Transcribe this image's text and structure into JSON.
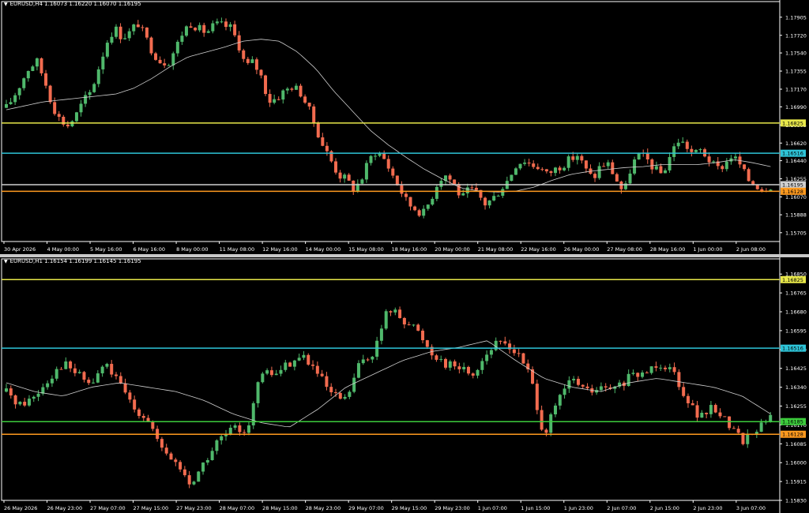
{
  "colors": {
    "background": "#000000",
    "axis": "#ffffff",
    "bull": "#4fb86b",
    "bear": "#f26b4f",
    "ma": "#d0d0d0",
    "yellow": "#e8e84a",
    "cyan": "#2ec4d8",
    "orange": "#ff9a1f",
    "green": "#3ccc3c",
    "gray": "#cfcfcf"
  },
  "chart_data": [
    {
      "type": "candlestick",
      "title": "EURUSD,H4",
      "ohlc": {
        "open": "1.16073",
        "high": "1.16220",
        "low": "1.16070",
        "close": "1.16195"
      },
      "ylim": [
        1.15615,
        1.18
      ],
      "yticks": [
        "1.17905",
        "1.17720",
        "1.17540",
        "1.17355",
        "1.17170",
        "1.16990",
        "1.16805",
        "1.16620",
        "1.16440",
        "1.16255",
        "1.16070",
        "1.15888",
        "1.15705"
      ],
      "xticks": [
        "30 Apr 2026",
        "4 May 00:00",
        "5 May 16:00",
        "6 May 16:00",
        "8 May 00:00",
        "11 May 08:00",
        "12 May 16:00",
        "14 May 00:00",
        "15 May 08:00",
        "18 May 16:00",
        "20 May 00:00",
        "21 May 08:00",
        "22 May 16:00",
        "26 May 00:00",
        "27 May 08:00",
        "28 May 16:00",
        "1 Jun 00:00",
        "2 Jun 08:00"
      ],
      "levels": [
        {
          "value": 1.16825,
          "label": "1.16825",
          "color": "yellow"
        },
        {
          "value": 1.16516,
          "label": "1.16516",
          "color": "cyan"
        },
        {
          "value": 1.16195,
          "label": "1.16195",
          "color": "gray"
        },
        {
          "value": 1.16128,
          "label": "1.16128",
          "color": "orange"
        }
      ],
      "close_path": [
        1.1698,
        1.171,
        1.1725,
        1.174,
        1.1745,
        1.1725,
        1.17,
        1.1685,
        1.168,
        1.169,
        1.1705,
        1.1715,
        1.174,
        1.1765,
        1.178,
        1.177,
        1.1775,
        1.1785,
        1.177,
        1.1755,
        1.1745,
        1.1745,
        1.176,
        1.1778,
        1.1785,
        1.1778,
        1.1775,
        1.1783,
        1.1782,
        1.178,
        1.1765,
        1.174,
        1.1745,
        1.173,
        1.1705,
        1.1708,
        1.1715,
        1.172,
        1.1715,
        1.17,
        1.168,
        1.166,
        1.1645,
        1.163,
        1.1625,
        1.1615,
        1.1625,
        1.1645,
        1.1655,
        1.1645,
        1.163,
        1.1615,
        1.16,
        1.1595,
        1.159,
        1.1605,
        1.1625,
        1.163,
        1.162,
        1.1605,
        1.1615,
        1.161,
        1.16,
        1.1605,
        1.1615,
        1.1625,
        1.164,
        1.1645,
        1.164,
        1.1638,
        1.163,
        1.1635,
        1.164,
        1.1645,
        1.165,
        1.1635,
        1.1625,
        1.164,
        1.164,
        1.1625,
        1.161,
        1.164,
        1.165,
        1.1645,
        1.1635,
        1.163,
        1.165,
        1.1665,
        1.166,
        1.165,
        1.1655,
        1.1645,
        1.1635,
        1.164,
        1.165,
        1.164,
        1.1625,
        1.162,
        1.1615,
        1.1619
      ],
      "ma_path": [
        1.1696,
        1.17,
        1.1704,
        1.1706,
        1.1708,
        1.171,
        1.1712,
        1.1718,
        1.1728,
        1.174,
        1.175,
        1.1755,
        1.176,
        1.1766,
        1.1768,
        1.1766,
        1.1755,
        1.1738,
        1.1715,
        1.1695,
        1.1675,
        1.166,
        1.1647,
        1.1635,
        1.1625,
        1.1616,
        1.1613,
        1.1612,
        1.1613,
        1.1617,
        1.1624,
        1.163,
        1.1633,
        1.1635,
        1.1637,
        1.1638,
        1.164,
        1.164,
        1.164,
        1.1642,
        1.1645,
        1.1642,
        1.1638
      ]
    },
    {
      "type": "candlestick",
      "title": "EURUSD,H1",
      "ohlc": {
        "open": "1.16154",
        "high": "1.16199",
        "low": "1.16145",
        "close": "1.16195"
      },
      "ylim": [
        1.1583,
        1.1689
      ],
      "yticks": [
        "1.16850",
        "1.16765",
        "1.16680",
        "1.16595",
        "1.16510",
        "1.16425",
        "1.16340",
        "1.16255",
        "1.16170",
        "1.16085",
        "1.16000",
        "1.15915",
        "1.15830"
      ],
      "xticks": [
        "26 May 2026",
        "26 May 23:00",
        "27 May 07:00",
        "27 May 15:00",
        "27 May 23:00",
        "28 May 07:00",
        "28 May 15:00",
        "28 May 23:00",
        "29 May 07:00",
        "29 May 15:00",
        "29 May 23:00",
        "1 Jun 07:00",
        "1 Jun 15:00",
        "1 Jun 23:00",
        "2 Jun 07:00",
        "2 Jun 15:00",
        "2 Jun 23:00",
        "3 Jun 07:00"
      ],
      "levels": [
        {
          "value": 1.16825,
          "label": "1.16825",
          "color": "yellow"
        },
        {
          "value": 1.16516,
          "label": "1.16516",
          "color": "cyan"
        },
        {
          "value": 1.16185,
          "label": "1.16185",
          "color": "green"
        },
        {
          "value": 1.16128,
          "label": "1.16128",
          "color": "orange"
        }
      ],
      "close_path": [
        1.1632,
        1.1626,
        1.163,
        1.1638,
        1.1645,
        1.164,
        1.1635,
        1.1645,
        1.1635,
        1.1625,
        1.162,
        1.1605,
        1.16,
        1.159,
        1.16,
        1.161,
        1.1615,
        1.1615,
        1.164,
        1.164,
        1.1645,
        1.1648,
        1.164,
        1.163,
        1.1628,
        1.1645,
        1.165,
        1.167,
        1.1665,
        1.166,
        1.165,
        1.1645,
        1.1643,
        1.164,
        1.165,
        1.1655,
        1.165,
        1.164,
        1.1612,
        1.1628,
        1.1638,
        1.1632,
        1.1633,
        1.1633,
        1.1638,
        1.164,
        1.1645,
        1.1643,
        1.163,
        1.162,
        1.1625,
        1.1618,
        1.161,
        1.1615,
        1.162
      ],
      "ma_path": [
        1.1636,
        1.1632,
        1.163,
        1.1634,
        1.1636,
        1.1634,
        1.1632,
        1.1628,
        1.1622,
        1.1618,
        1.1616,
        1.1624,
        1.1634,
        1.164,
        1.1646,
        1.165,
        1.1652,
        1.1655,
        1.1646,
        1.1638,
        1.1634,
        1.1632,
        1.1636,
        1.1638,
        1.1636,
        1.1634,
        1.163,
        1.1622
      ]
    }
  ]
}
